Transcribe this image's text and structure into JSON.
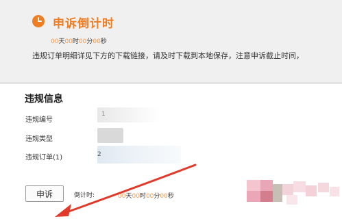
{
  "appeal_countdown": {
    "title": "申诉倒计时",
    "days": "00",
    "days_unit": "天",
    "hours": "00",
    "hours_unit": "时",
    "minutes": "00",
    "minutes_unit": "分",
    "seconds": "00",
    "seconds_unit": "秒",
    "notice": "违规订单明细详见下方的下载链接，请及时下载到本地保存，注意申诉截止时间，"
  },
  "violation_info": {
    "title": "违规信息",
    "fields": [
      {
        "label": "违规编号",
        "value": "1"
      },
      {
        "label": "违规类型",
        "value": ""
      },
      {
        "label": "违规订单(1)",
        "value": "2"
      }
    ]
  },
  "footer": {
    "appeal_button_label": "申诉",
    "countdown_label": "倒计时:",
    "days": "00",
    "days_unit": "天",
    "hours": "00",
    "hours_unit": "时",
    "minutes": "00",
    "minutes_unit": "分",
    "seconds": "00",
    "seconds_unit": "秒"
  },
  "colors": {
    "accent": "#ef7d22",
    "arrow": "#e03a2a",
    "panel_bg": "#f0f0f0"
  }
}
